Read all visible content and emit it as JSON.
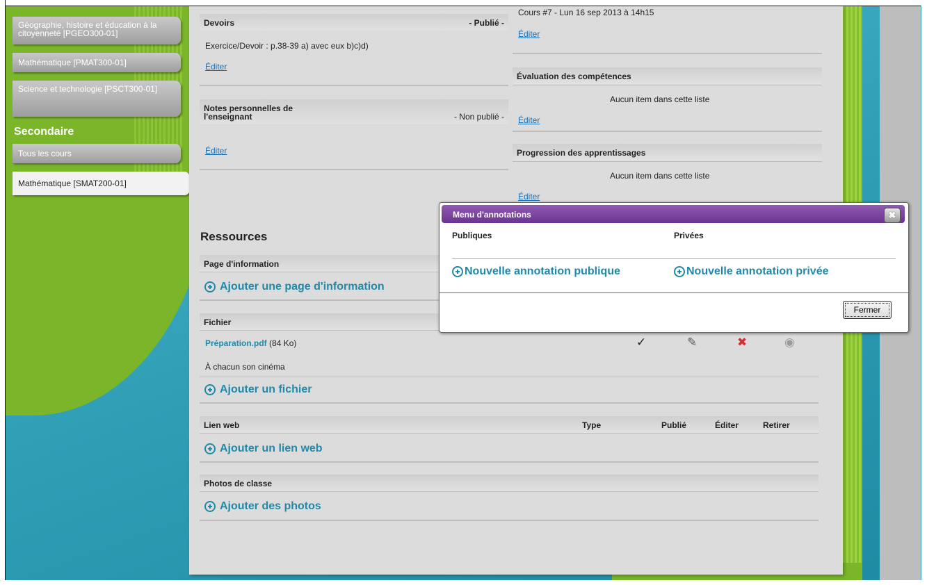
{
  "sidebar": {
    "items": [
      {
        "label": "Géographie, histoire et éducation à la citoyenneté [PGEO300-01]"
      },
      {
        "label": "Mathématique [PMAT300-01]"
      },
      {
        "label": "Science et technologie [PSCT300-01]"
      }
    ],
    "section_heading": "Secondaire",
    "secondary_items": [
      {
        "label": "Tous les cours"
      },
      {
        "label": "Mathématique [SMAT200-01]"
      }
    ]
  },
  "devoirs": {
    "title": "Devoirs",
    "status": "- Publié -",
    "text": "Exercice/Devoir : p.38-39 a) avec eux b)c)d)",
    "edit": "Éditer"
  },
  "notes": {
    "title": "Notes personnelles de l'enseignant",
    "status": "- Non publié -",
    "edit": "Éditer"
  },
  "cours": {
    "text": "Cours #7 - Lun 16 sep 2013 à 14h15",
    "edit": "Éditer"
  },
  "evaluation": {
    "title": "Évaluation des compétences",
    "empty": "Aucun item dans cette liste",
    "edit": "Éditer"
  },
  "progression": {
    "title": "Progression des apprentissages",
    "empty": "Aucun item dans cette liste",
    "edit": "Éditer"
  },
  "ressources": {
    "title": "Ressources",
    "page_info": {
      "title": "Page d'information",
      "add": "Ajouter une page d'information"
    },
    "fichier": {
      "title": "Fichier",
      "file_name": "Préparation.pdf",
      "file_size": "(84 Ko)",
      "description": "À chacun son cinéma",
      "add": "Ajouter un fichier"
    },
    "lien_web": {
      "title": "Lien web",
      "col_type": "Type",
      "col_publie": "Publié",
      "col_editer": "Éditer",
      "col_retirer": "Retirer",
      "add": "Ajouter un lien web"
    },
    "photos": {
      "title": "Photos de classe",
      "add": "Ajouter des photos"
    }
  },
  "dialog": {
    "title": "Menu d'annotations",
    "close_glyph": "✖",
    "col_public": "Publiques",
    "col_private": "Privées",
    "add_public": "Nouvelle annotation publique",
    "add_private": "Nouvelle annotation privée",
    "close_button": "Fermer"
  },
  "icons": {
    "check": "✓",
    "edit": "✎",
    "delete": "✖",
    "view": "◉"
  },
  "colors": {
    "link": "#1a6fb3",
    "accent": "#2189a8",
    "dialog_header": "#7a3f9d",
    "green": "#7ab52a",
    "delete_red": "#d23030"
  }
}
